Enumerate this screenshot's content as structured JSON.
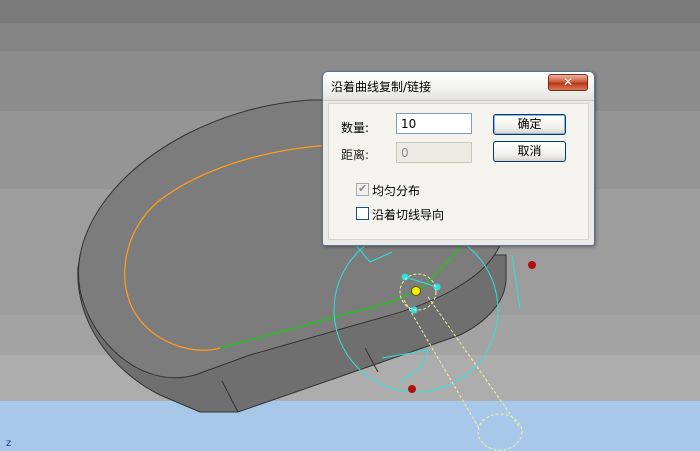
{
  "dialog": {
    "title": "沿着曲线复制/链接",
    "close_symbol": "✕",
    "count_label": "数量:",
    "count_value": "10",
    "distance_label": "距离:",
    "distance_value": "0",
    "ok_label": "确定",
    "cancel_label": "取消",
    "even_distribution_label": "均匀分布",
    "even_distribution_checked": true,
    "follow_tangent_label": "沿着切线导向",
    "follow_tangent_checked": false
  },
  "viewport": {
    "axis_label": "z",
    "colors": {
      "path_curve": "#ff9a1e",
      "selected_segment": "#22c31a",
      "gizmo": "#2fe0e0",
      "dashed_link": "#f2f2a0",
      "control_point": "#c41010",
      "ground": "#a8c8ea"
    }
  }
}
